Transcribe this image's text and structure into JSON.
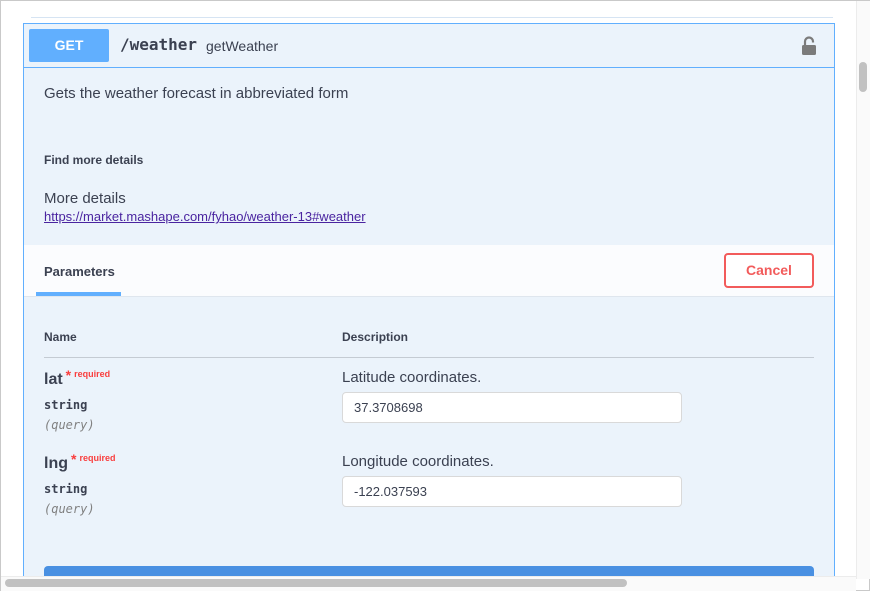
{
  "operation": {
    "method": "GET",
    "path": "/weather",
    "operation_id": "getWeather",
    "description": "Gets the weather forecast in abbreviated form",
    "find_more_heading": "Find more details",
    "more_details_label": "More details",
    "more_details_url": "https://market.mashape.com/fyhao/weather-13#weather",
    "lock_icon": "unlock-icon"
  },
  "parameters": {
    "tab_label": "Parameters",
    "cancel_label": "Cancel",
    "columns": {
      "name": "Name",
      "description": "Description"
    },
    "items": [
      {
        "name": "lat",
        "star": "*",
        "required_label": "required",
        "type": "string",
        "in": "(query)",
        "description": "Latitude coordinates.",
        "value": "37.3708698"
      },
      {
        "name": "lng",
        "star": "*",
        "required_label": "required",
        "type": "string",
        "in": "(query)",
        "description": "Longitude coordinates.",
        "value": "-122.037593"
      }
    ]
  },
  "colors": {
    "get_accent": "#61affe",
    "cancel_red": "#f25b5b",
    "execute_blue": "#4990e2"
  }
}
